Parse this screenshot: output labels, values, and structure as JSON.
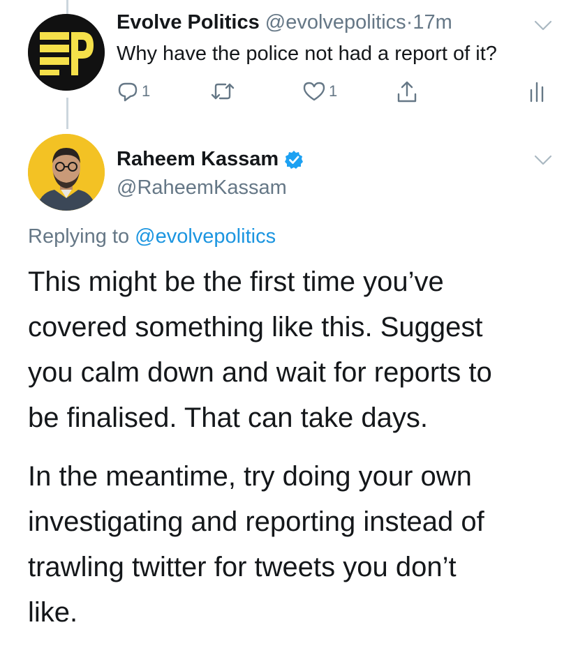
{
  "tweet1": {
    "name": "Evolve Politics",
    "handle": "@evolvepolitics",
    "separator": "·",
    "time": "17m",
    "text": "Why have the police not had a report of it?",
    "reply_count": "1",
    "like_count": "1"
  },
  "tweet2": {
    "name": "Raheem Kassam",
    "handle": "@RaheemKassam",
    "replying_prefix": "Replying to",
    "replying_handle": "@evolvepolitics",
    "paragraph1_lines": [
      "This might be the first time you’ve",
      "covered something like this. Suggest",
      "you calm down and wait for reports to",
      "be finalised. That can take days."
    ],
    "paragraph2_lines": [
      "In the meantime, try doing your own",
      "investigating and reporting instead of",
      "trawling twitter for tweets you don’t",
      "like."
    ]
  },
  "colors": {
    "text": "#14171a",
    "secondary": "#657786",
    "link": "#1b95e0",
    "verified": "#1da1f2",
    "logo_yellow": "#f5e04a"
  },
  "icons": {
    "reply": "reply-icon",
    "retweet": "retweet-icon",
    "like": "heart-icon",
    "share": "share-icon",
    "analytics": "analytics-icon",
    "menu": "chevron-down-icon",
    "verified": "verified-badge-icon"
  }
}
